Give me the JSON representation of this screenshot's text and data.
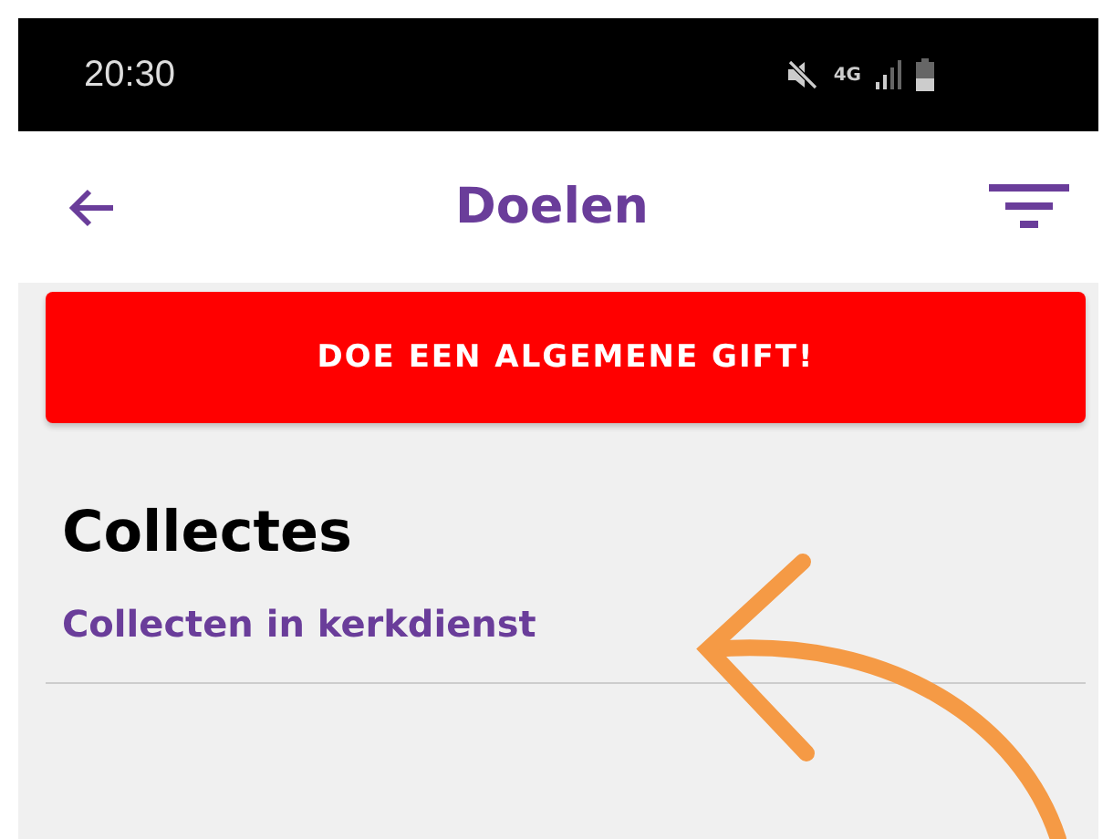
{
  "status_bar": {
    "time": "20:30",
    "network": "4G"
  },
  "header": {
    "title": "Doelen"
  },
  "general_gift_button": {
    "label": "DOE EEN ALGEMENE GIFT!"
  },
  "section": {
    "title": "Collectes",
    "items": [
      {
        "label": "Collecten in kerkdienst"
      }
    ]
  }
}
